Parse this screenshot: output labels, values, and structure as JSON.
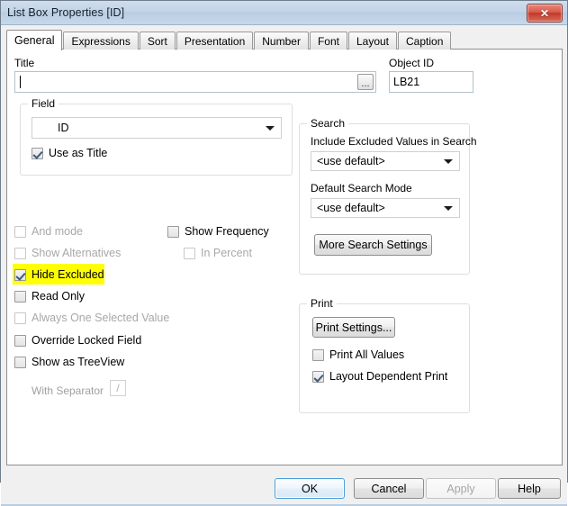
{
  "window": {
    "title": "List Box Properties [ID]",
    "close_label": "✕"
  },
  "tabs": [
    {
      "label": "General",
      "active": true
    },
    {
      "label": "Expressions",
      "active": false
    },
    {
      "label": "Sort",
      "active": false
    },
    {
      "label": "Presentation",
      "active": false
    },
    {
      "label": "Number",
      "active": false
    },
    {
      "label": "Font",
      "active": false
    },
    {
      "label": "Layout",
      "active": false
    },
    {
      "label": "Caption",
      "active": false
    }
  ],
  "general": {
    "title_label": "Title",
    "title_value": "",
    "title_ellipsis": "...",
    "object_id_label": "Object ID",
    "object_id_value": "LB21",
    "field_group": {
      "title": "Field",
      "selected_field": "ID",
      "use_as_title_label": "Use as Title",
      "use_as_title_checked": true
    },
    "options": [
      {
        "label": "And mode",
        "checked": false,
        "enabled": false,
        "highlight": false
      },
      {
        "label": "Show Alternatives",
        "checked": false,
        "enabled": false,
        "highlight": false
      },
      {
        "label": "Hide Excluded",
        "checked": true,
        "enabled": true,
        "highlight": true
      },
      {
        "label": "Read Only",
        "checked": false,
        "enabled": true,
        "highlight": false
      },
      {
        "label": "Always One Selected Value",
        "checked": false,
        "enabled": false,
        "highlight": false
      },
      {
        "label": "Override Locked Field",
        "checked": false,
        "enabled": true,
        "highlight": false
      },
      {
        "label": "Show as TreeView",
        "checked": false,
        "enabled": true,
        "highlight": false
      }
    ],
    "show_frequency": {
      "label": "Show Frequency",
      "checked": false,
      "enabled": true
    },
    "in_percent": {
      "label": "In Percent",
      "checked": false,
      "enabled": false
    },
    "with_separator": {
      "label": "With Separator",
      "value": "/",
      "enabled": false
    }
  },
  "search_group": {
    "title": "Search",
    "include_excluded_label": "Include Excluded Values in Search",
    "include_excluded_value": "<use default>",
    "default_search_mode_label": "Default Search Mode",
    "default_search_mode_value": "<use default>",
    "more_search_settings_label": "More Search Settings"
  },
  "print_group": {
    "title": "Print",
    "print_settings_label": "Print Settings...",
    "print_all_values": {
      "label": "Print All Values",
      "checked": false
    },
    "layout_dependent_print": {
      "label": "Layout Dependent Print",
      "checked": true
    }
  },
  "footer": {
    "ok": "OK",
    "cancel": "Cancel",
    "apply": "Apply",
    "help": "Help",
    "apply_enabled": false,
    "ok_is_default": true
  },
  "colors": {
    "highlight": "#ffff00",
    "titlebar": "#c3d4e8",
    "close_button": "#c0392b",
    "default_button_border": "#4c9ed9"
  }
}
